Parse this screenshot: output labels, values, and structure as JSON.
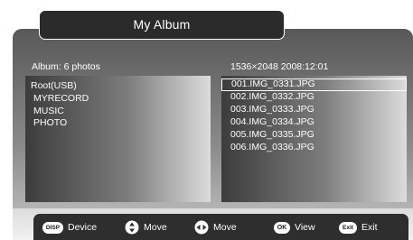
{
  "window": {
    "title": "My Album"
  },
  "album": {
    "info": "Album: 6 photos"
  },
  "image": {
    "info": "1536×2048 2008:12:01"
  },
  "folders": [
    {
      "label": "Root(USB)"
    },
    {
      "label": "MYRECORD"
    },
    {
      "label": "MUSIC"
    },
    {
      "label": "PHOTO"
    }
  ],
  "files": [
    {
      "label": "001.IMG_0331.JPG",
      "selected": true
    },
    {
      "label": "002.IMG_0332.JPG"
    },
    {
      "label": "003.IMG_0333.JPG"
    },
    {
      "label": "004.IMG_0334.JPG"
    },
    {
      "label": "005.IMG_0335.JPG"
    },
    {
      "label": "006.IMG_0336.JPG"
    }
  ],
  "footer": {
    "device": {
      "key": "DISP",
      "label": "Device"
    },
    "move_vertical": {
      "icon": "dpad-updown-icon",
      "label": "Move"
    },
    "move_horizontal": {
      "icon": "dpad-leftright-icon",
      "label": "Move"
    },
    "view": {
      "key": "OK",
      "label": "View"
    },
    "exit": {
      "key": "Exit",
      "label": "Exit"
    }
  },
  "colors": {
    "bar": "#2e2e2e",
    "text": "#ffffff"
  }
}
